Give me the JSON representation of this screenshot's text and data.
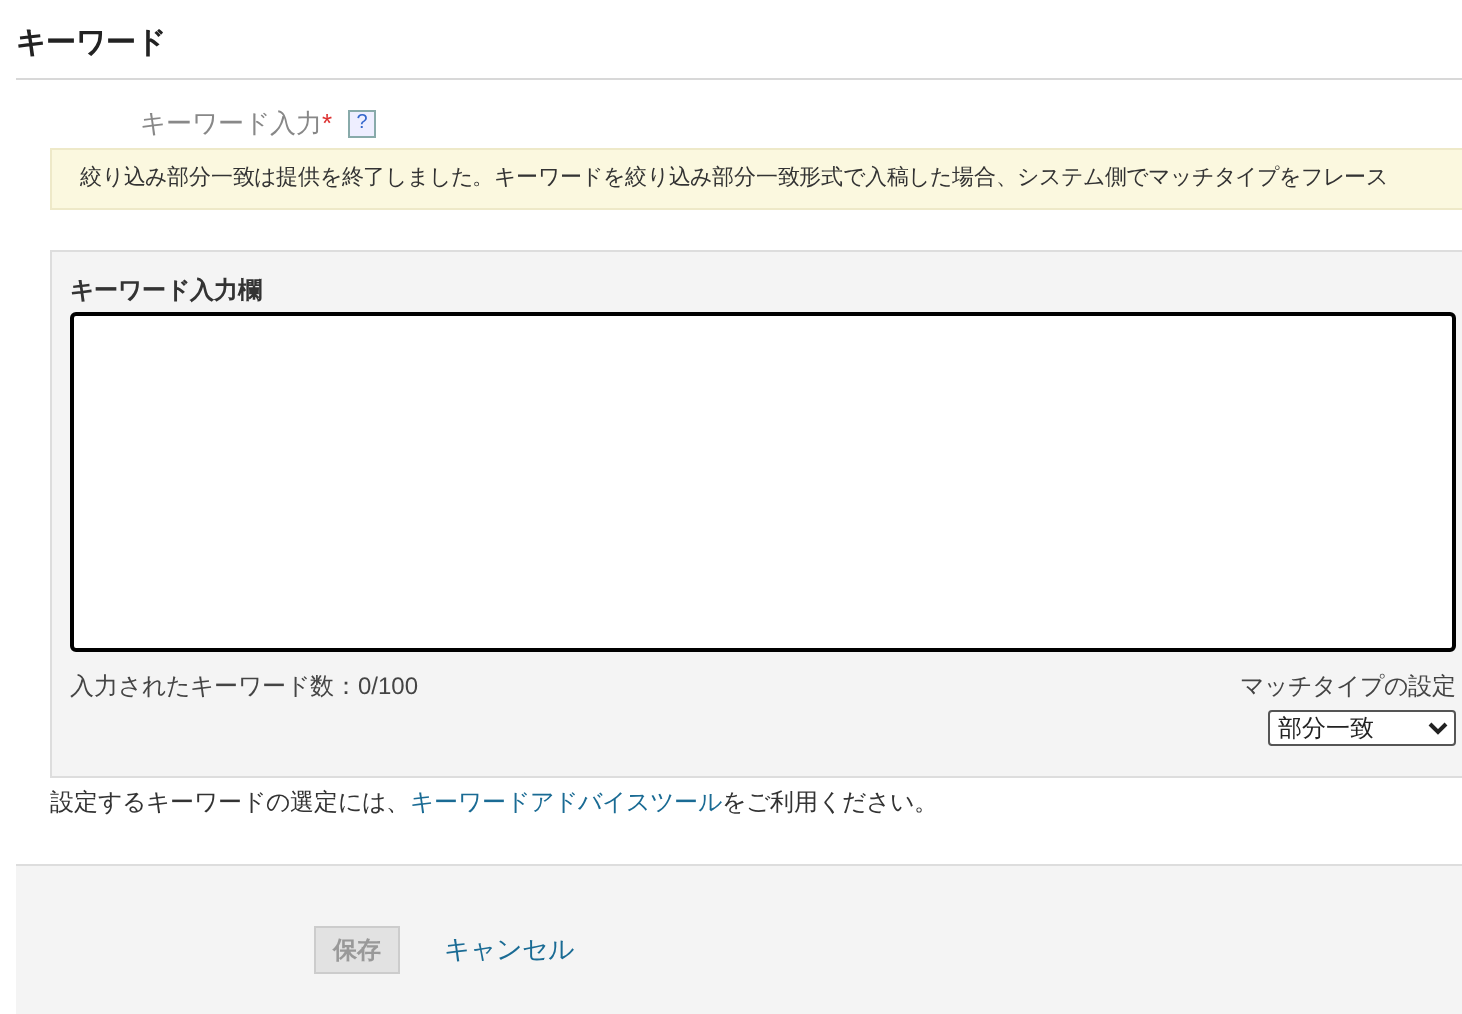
{
  "section_title": "キーワード",
  "field_label": "キーワード入力",
  "required_mark": "*",
  "help_icon": "?",
  "notice": "絞り込み部分一致は提供を終了しました。キーワードを絞り込み部分一致形式で入稿した場合、システム側でマッチタイプをフレース",
  "input_panel": {
    "title": "キーワード入力欄",
    "counter": "入力されたキーワード数：0/100",
    "match_type_label": "マッチタイプの設定",
    "match_type_value": "部分一致"
  },
  "advice": {
    "before": "設定するキーワードの選定には、",
    "link": "キーワードアドバイスツール",
    "after": "をご利用ください。"
  },
  "buttons": [
    {
      "kind": "primary",
      "label": "保存",
      "disabled": true
    },
    {
      "kind": "link",
      "label": "キャンセル",
      "disabled": false
    }
  ]
}
